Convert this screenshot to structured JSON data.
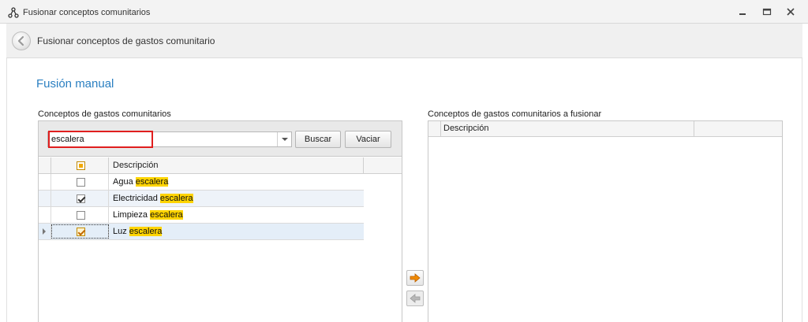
{
  "window": {
    "title": "Fusionar conceptos comunitarios"
  },
  "header": {
    "title": "Fusionar conceptos de gastos comunitario"
  },
  "main": {
    "section_title": "Fusión manual",
    "left": {
      "label": "Conceptos de gastos comunitarios",
      "search_value": "escalera",
      "buscar_label": "Buscar",
      "vaciar_label": "Vaciar",
      "column_header": "Descripción",
      "rows": [
        {
          "prefix": "Agua ",
          "match": "escalera",
          "checked": false
        },
        {
          "prefix": "Electricidad ",
          "match": "escalera",
          "checked": true
        },
        {
          "prefix": "Limpieza ",
          "match": "escalera",
          "checked": false
        },
        {
          "prefix": "Luz ",
          "match": "escalera",
          "checked": true
        }
      ]
    },
    "right": {
      "label": "Conceptos de gastos comunitarios a fusionar",
      "column_header": "Descripción"
    }
  },
  "colors": {
    "accent": "#2a7fc1",
    "highlight": "#ffd400",
    "search_border": "#e01e1e",
    "arrow_orange": "#f08a00"
  }
}
